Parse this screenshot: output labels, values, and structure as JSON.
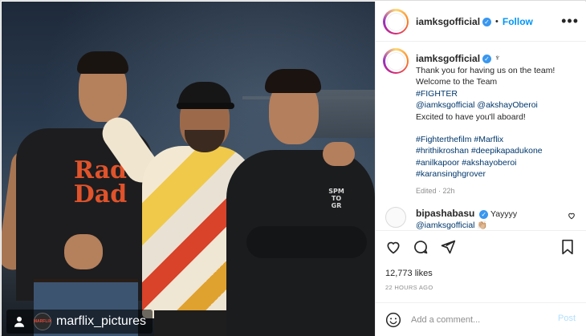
{
  "photo": {
    "tshirt_text": [
      "Rad",
      "Dad"
    ],
    "hoodie_text": [
      "SPM",
      "TO",
      "GR"
    ],
    "watermark": {
      "logo_text": "MARFLIX",
      "handle": "marflix_pictures"
    }
  },
  "header": {
    "username": "iamksgofficial",
    "verified_icon": "verified-badge-icon",
    "separator": "•",
    "follow_label": "Follow",
    "more_icon": "•••"
  },
  "caption": {
    "username": "iamksgofficial",
    "trident": "♆",
    "lines": {
      "l1": "Thank you for having us on the team!",
      "l2": "Welcome to the Team",
      "l3": "#FIGHTER",
      "l4a": "@iamksgofficial",
      "l4b": "@akshayOberoi",
      "l5": "Excited to have you'll aboard!",
      "l6a": "#Fighterthefilm",
      "l6b": "#Marflix",
      "l7a": "#hrithikroshan",
      "l7b": "#deepikapadukone",
      "l8a": "#anilkapoor",
      "l8b": "#akshayoberoi",
      "l9": "#karansinghgrover"
    },
    "edited": "Edited · 22h"
  },
  "comment": {
    "username": "bipashabasu",
    "text": "Yayyyy",
    "mention": "@iamksgofficial",
    "emoji": "👏🏼"
  },
  "actions": {
    "likes": "12,773 likes",
    "time": "22 HOURS AGO"
  },
  "add_comment": {
    "placeholder": "Add a comment...",
    "post_label": "Post"
  },
  "colors": {
    "link": "#00376b",
    "follow": "#0095f6",
    "verified": "#3897f0",
    "post_disabled": "#b2dffc",
    "muted": "#8e8e8e"
  }
}
